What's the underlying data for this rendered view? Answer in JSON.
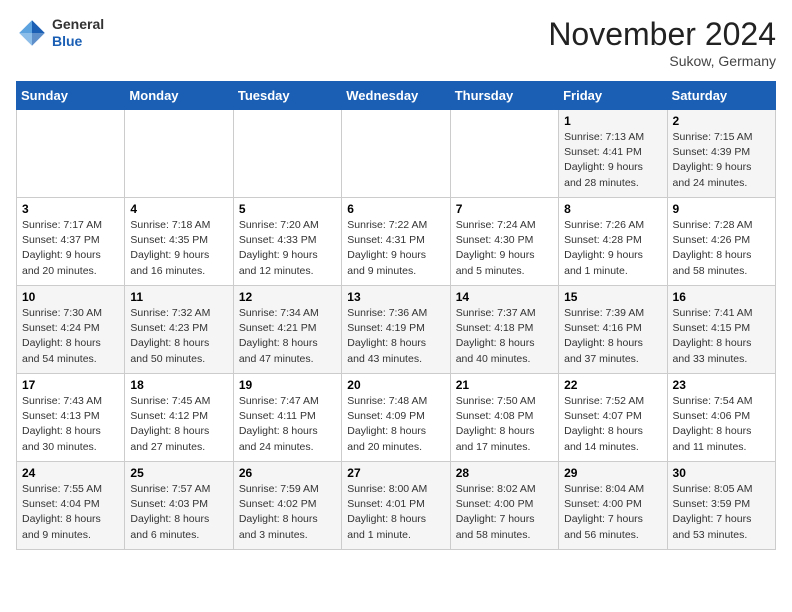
{
  "header": {
    "logo_general": "General",
    "logo_blue": "Blue",
    "month_title": "November 2024",
    "location": "Sukow, Germany"
  },
  "weekdays": [
    "Sunday",
    "Monday",
    "Tuesday",
    "Wednesday",
    "Thursday",
    "Friday",
    "Saturday"
  ],
  "weeks": [
    [
      {
        "day": "",
        "info": ""
      },
      {
        "day": "",
        "info": ""
      },
      {
        "day": "",
        "info": ""
      },
      {
        "day": "",
        "info": ""
      },
      {
        "day": "",
        "info": ""
      },
      {
        "day": "1",
        "info": "Sunrise: 7:13 AM\nSunset: 4:41 PM\nDaylight: 9 hours\nand 28 minutes."
      },
      {
        "day": "2",
        "info": "Sunrise: 7:15 AM\nSunset: 4:39 PM\nDaylight: 9 hours\nand 24 minutes."
      }
    ],
    [
      {
        "day": "3",
        "info": "Sunrise: 7:17 AM\nSunset: 4:37 PM\nDaylight: 9 hours\nand 20 minutes."
      },
      {
        "day": "4",
        "info": "Sunrise: 7:18 AM\nSunset: 4:35 PM\nDaylight: 9 hours\nand 16 minutes."
      },
      {
        "day": "5",
        "info": "Sunrise: 7:20 AM\nSunset: 4:33 PM\nDaylight: 9 hours\nand 12 minutes."
      },
      {
        "day": "6",
        "info": "Sunrise: 7:22 AM\nSunset: 4:31 PM\nDaylight: 9 hours\nand 9 minutes."
      },
      {
        "day": "7",
        "info": "Sunrise: 7:24 AM\nSunset: 4:30 PM\nDaylight: 9 hours\nand 5 minutes."
      },
      {
        "day": "8",
        "info": "Sunrise: 7:26 AM\nSunset: 4:28 PM\nDaylight: 9 hours\nand 1 minute."
      },
      {
        "day": "9",
        "info": "Sunrise: 7:28 AM\nSunset: 4:26 PM\nDaylight: 8 hours\nand 58 minutes."
      }
    ],
    [
      {
        "day": "10",
        "info": "Sunrise: 7:30 AM\nSunset: 4:24 PM\nDaylight: 8 hours\nand 54 minutes."
      },
      {
        "day": "11",
        "info": "Sunrise: 7:32 AM\nSunset: 4:23 PM\nDaylight: 8 hours\nand 50 minutes."
      },
      {
        "day": "12",
        "info": "Sunrise: 7:34 AM\nSunset: 4:21 PM\nDaylight: 8 hours\nand 47 minutes."
      },
      {
        "day": "13",
        "info": "Sunrise: 7:36 AM\nSunset: 4:19 PM\nDaylight: 8 hours\nand 43 minutes."
      },
      {
        "day": "14",
        "info": "Sunrise: 7:37 AM\nSunset: 4:18 PM\nDaylight: 8 hours\nand 40 minutes."
      },
      {
        "day": "15",
        "info": "Sunrise: 7:39 AM\nSunset: 4:16 PM\nDaylight: 8 hours\nand 37 minutes."
      },
      {
        "day": "16",
        "info": "Sunrise: 7:41 AM\nSunset: 4:15 PM\nDaylight: 8 hours\nand 33 minutes."
      }
    ],
    [
      {
        "day": "17",
        "info": "Sunrise: 7:43 AM\nSunset: 4:13 PM\nDaylight: 8 hours\nand 30 minutes."
      },
      {
        "day": "18",
        "info": "Sunrise: 7:45 AM\nSunset: 4:12 PM\nDaylight: 8 hours\nand 27 minutes."
      },
      {
        "day": "19",
        "info": "Sunrise: 7:47 AM\nSunset: 4:11 PM\nDaylight: 8 hours\nand 24 minutes."
      },
      {
        "day": "20",
        "info": "Sunrise: 7:48 AM\nSunset: 4:09 PM\nDaylight: 8 hours\nand 20 minutes."
      },
      {
        "day": "21",
        "info": "Sunrise: 7:50 AM\nSunset: 4:08 PM\nDaylight: 8 hours\nand 17 minutes."
      },
      {
        "day": "22",
        "info": "Sunrise: 7:52 AM\nSunset: 4:07 PM\nDaylight: 8 hours\nand 14 minutes."
      },
      {
        "day": "23",
        "info": "Sunrise: 7:54 AM\nSunset: 4:06 PM\nDaylight: 8 hours\nand 11 minutes."
      }
    ],
    [
      {
        "day": "24",
        "info": "Sunrise: 7:55 AM\nSunset: 4:04 PM\nDaylight: 8 hours\nand 9 minutes."
      },
      {
        "day": "25",
        "info": "Sunrise: 7:57 AM\nSunset: 4:03 PM\nDaylight: 8 hours\nand 6 minutes."
      },
      {
        "day": "26",
        "info": "Sunrise: 7:59 AM\nSunset: 4:02 PM\nDaylight: 8 hours\nand 3 minutes."
      },
      {
        "day": "27",
        "info": "Sunrise: 8:00 AM\nSunset: 4:01 PM\nDaylight: 8 hours\nand 1 minute."
      },
      {
        "day": "28",
        "info": "Sunrise: 8:02 AM\nSunset: 4:00 PM\nDaylight: 7 hours\nand 58 minutes."
      },
      {
        "day": "29",
        "info": "Sunrise: 8:04 AM\nSunset: 4:00 PM\nDaylight: 7 hours\nand 56 minutes."
      },
      {
        "day": "30",
        "info": "Sunrise: 8:05 AM\nSunset: 3:59 PM\nDaylight: 7 hours\nand 53 minutes."
      }
    ]
  ]
}
